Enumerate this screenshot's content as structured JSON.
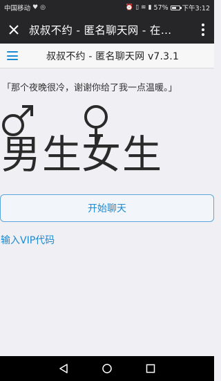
{
  "statusbar": {
    "carrier": "中国移动",
    "battery": "57%",
    "time": "下午3:12"
  },
  "appbar": {
    "title": "叔叔不约 - 匿名聊天网 - 在…"
  },
  "page": {
    "title": "叔叔不约 - 匿名聊天网 v7.3.1",
    "quote": "「那个夜晚很冷，谢谢你给了我一点温暖。」",
    "male_label": "男生",
    "female_label": "女生",
    "start_button": "开始聊天",
    "vip_link": "输入VIP代码"
  },
  "colors": {
    "accent": "#1a8ad4",
    "statusbar_bg": "#262628",
    "page_bg": "#efeff4"
  }
}
